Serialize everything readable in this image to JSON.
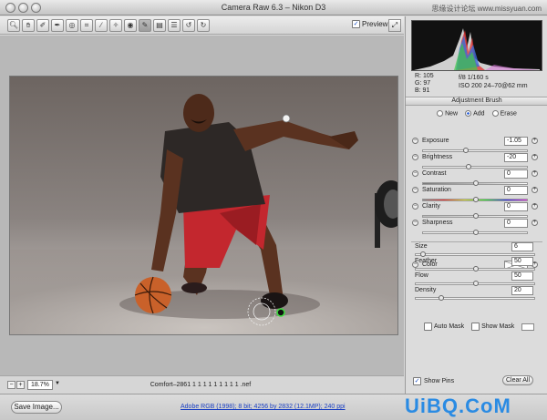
{
  "window": {
    "title": "Camera Raw 6.3  –  Nikon D3",
    "watermark_top": "思缘设计论坛  www.missyuan.com"
  },
  "toolbar": {
    "preview_label": "Preview",
    "preview_checked": true,
    "tools": [
      "zoom-icon",
      "hand-icon",
      "eyedropper-icon",
      "color-sampler-icon",
      "target-icon",
      "crop-icon",
      "straighten-icon",
      "spot-removal-icon",
      "red-eye-icon",
      "adjustment-brush-icon",
      "graduated-filter-icon",
      "preferences-icon",
      "rotate-ccw-icon",
      "rotate-cw-icon"
    ]
  },
  "readout": {
    "r": "R:   105",
    "g": "G:     97",
    "b": "B:     91",
    "aperture": "f/8   1/160 s",
    "iso": "ISO 200   24–70@62 mm"
  },
  "adjustment": {
    "header": "Adjustment Brush",
    "modes": {
      "new": "New",
      "add": "Add",
      "erase": "Erase"
    },
    "sliders": [
      {
        "label": "Exposure",
        "value": "-1.05",
        "pos": 0.4
      },
      {
        "label": "Brightness",
        "value": "-20",
        "pos": 0.43
      },
      {
        "label": "Contrast",
        "value": "0",
        "pos": 0.5
      },
      {
        "label": "Saturation",
        "value": "0",
        "pos": 0.5
      },
      {
        "label": "Clarity",
        "value": "0",
        "pos": 0.5
      },
      {
        "label": "Sharpness",
        "value": "0",
        "pos": 0.5
      }
    ],
    "color_label": "Color",
    "brush": [
      {
        "label": "Size",
        "value": "6",
        "pos": 0.05
      },
      {
        "label": "Feather",
        "value": "50",
        "pos": 0.5
      },
      {
        "label": "Flow",
        "value": "50",
        "pos": 0.5
      },
      {
        "label": "Density",
        "value": "20",
        "pos": 0.2
      }
    ],
    "auto_mask": "Auto Mask",
    "show_mask": "Show Mask",
    "show_pins": "Show Pins",
    "clear_all": "Clear All"
  },
  "status": {
    "zoom": "18.7%",
    "filename": "Comfort–2861 1 1 1 1 1 1 1 1 1 .nef"
  },
  "bottom": {
    "save_image": "Save Image...",
    "workflow": "Adobe RGB (1998); 8 bit; 4256 by 2832 (12.1MP); 240 ppi",
    "watermark": "UiBQ.CoM"
  }
}
